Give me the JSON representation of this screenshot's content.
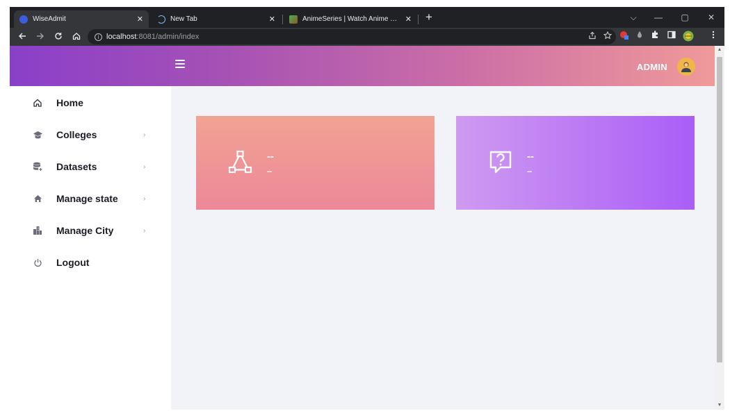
{
  "browser": {
    "tabs": [
      {
        "title": "WiseAdmit",
        "active": true
      },
      {
        "title": "New Tab",
        "active": false
      },
      {
        "title": "AnimeSeries | Watch Anime Onli",
        "active": false
      }
    ],
    "new_tab": "+",
    "close_glyph": "✕",
    "url_host": "localhost",
    "url_path": ":8081/admin/index",
    "window_controls": {
      "dropdown": "⌵",
      "minimize": "—",
      "maximize": "▢",
      "close": "✕"
    }
  },
  "header": {
    "menu_icon": "hamburger-icon",
    "username": "ADMIN",
    "gradient": [
      "#8a3fc9",
      "#ef9a9a"
    ]
  },
  "sidebar": {
    "items": [
      {
        "label": "Home",
        "icon": "home-icon",
        "arrow": ""
      },
      {
        "label": "Colleges",
        "icon": "graduation-cap-icon",
        "arrow": "›"
      },
      {
        "label": "Datasets",
        "icon": "database-icon",
        "arrow": "›"
      },
      {
        "label": "Manage state",
        "icon": "house-icon",
        "arrow": "›"
      },
      {
        "label": "Manage City",
        "icon": "city-icon",
        "arrow": "›"
      },
      {
        "label": "Logout",
        "icon": "power-icon",
        "arrow": ""
      }
    ]
  },
  "cards": [
    {
      "title": "--",
      "subtitle": "–",
      "icon": "network-icon",
      "colors": [
        "#f0a393",
        "#ee8798"
      ]
    },
    {
      "title": "--",
      "subtitle": "–",
      "icon": "question-chat-icon",
      "colors": [
        "#d09af1",
        "#a95ef7"
      ]
    }
  ]
}
